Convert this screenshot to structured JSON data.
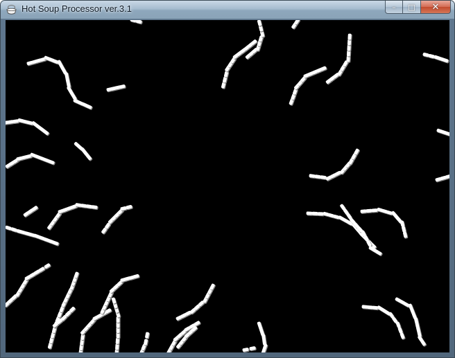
{
  "window": {
    "title": "Hot Soup Processor ver.3.1",
    "controls": {
      "minimize_glyph": "–",
      "maximize_glyph": "□",
      "close_glyph": "✕"
    },
    "app_icon": "soup-bowl-icon"
  },
  "colors": {
    "canvas_background": "#000000",
    "creature_color": "#ffffff",
    "creature_shadow": "#8a8a8a"
  }
}
